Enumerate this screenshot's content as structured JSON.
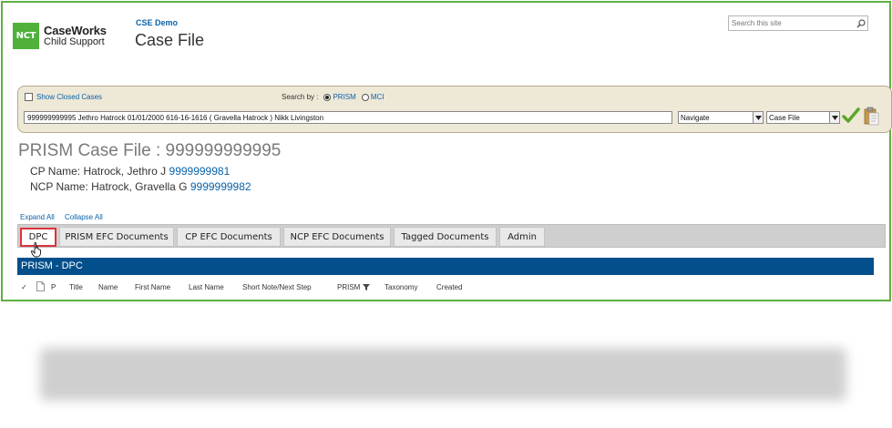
{
  "header": {
    "logo_mark": "NCT",
    "logo_brand": "CaseWorks",
    "logo_sub": "Child Support",
    "site_link": "CSE Demo",
    "page_title": "Case File",
    "search_placeholder": "Search this site",
    "search_icon": "magnifier-icon"
  },
  "case_search": {
    "show_closed_label": "Show Closed Cases",
    "search_by_label": "Search by :",
    "search_by_options": [
      "PRISM",
      "MCI"
    ],
    "search_by_selected": "PRISM",
    "case_value": "999999999995 Jethro Hatrock 01/01/2000 616-16-1616 ( Gravella Hatrock ) Nikk Livingston",
    "navigate_value": "Navigate",
    "view_value": "Case File"
  },
  "case": {
    "title": "PRISM Case File : 999999999995",
    "cp_label": "CP Name: Hatrock, Jethro J",
    "cp_id": "9999999981",
    "ncp_label": "NCP Name: Hatrock, Gravella G",
    "ncp_id": "9999999982"
  },
  "controls": {
    "expand_all": "Expand All",
    "collapse_all": "Collapse All"
  },
  "tabs": [
    {
      "label": "DPC",
      "active": true
    },
    {
      "label": "PRISM EFC Documents"
    },
    {
      "label": "CP EFC Documents"
    },
    {
      "label": "NCP EFC Documents"
    },
    {
      "label": "Tagged Documents"
    },
    {
      "label": "Admin"
    }
  ],
  "list": {
    "header": "PRISM - DPC",
    "columns": [
      "✓",
      "P",
      "Title",
      "Name",
      "First Name",
      "Last Name",
      "Short Note/Next Step",
      "PRISM",
      "Taxonomy",
      "Created"
    ]
  },
  "colors": {
    "accent_blue": "#034f8c",
    "link_blue": "#0a62a8",
    "frame_green": "#5db043",
    "active_tab_border": "#d9343a"
  }
}
